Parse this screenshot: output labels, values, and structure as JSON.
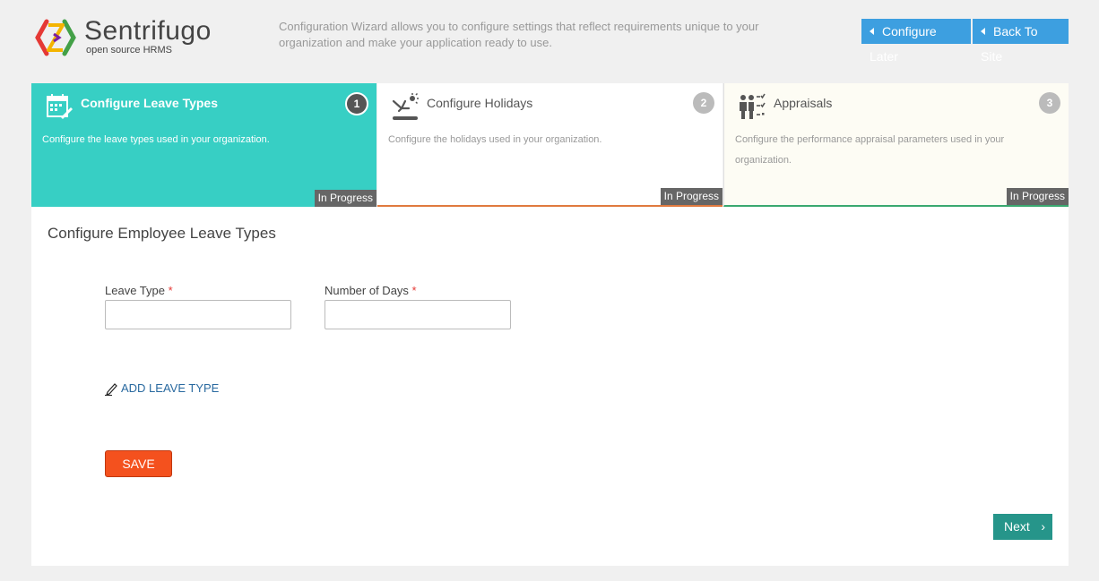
{
  "header": {
    "logo_name": "Sentrifugo",
    "logo_tagline": "open source HRMS",
    "intro_text": "Configuration Wizard allows you to configure settings that reflect requirements unique to your organization and make your application ready to use.",
    "configure_later_label": "Configure Later",
    "back_to_site_label": "Back To Site"
  },
  "steps": [
    {
      "number": "1",
      "title": "Configure Leave Types",
      "description": "Configure the leave types used in your organization.",
      "status": "In Progress",
      "icon": "calendar-edit-icon"
    },
    {
      "number": "2",
      "title": "Configure Holidays",
      "description": "Configure the holidays used in your organization.",
      "status": "In Progress",
      "icon": "holiday-plane-icon"
    },
    {
      "number": "3",
      "title": "Appraisals",
      "description": "Configure the performance appraisal parameters used in your organization.",
      "status": "In Progress",
      "icon": "appraisal-people-icon"
    }
  ],
  "form": {
    "title": "Configure Employee Leave Types",
    "leave_type_label": "Leave Type",
    "leave_type_value": "",
    "days_label": "Number of Days",
    "days_value": "",
    "required_mark": "*",
    "add_leave_type_label": "ADD LEAVE TYPE",
    "save_label": "SAVE",
    "next_label": "Next"
  },
  "colors": {
    "active_step": "#37cfc4",
    "header_button": "#3d9fe0",
    "save_button": "#f4511e",
    "next_button": "#26958a"
  }
}
